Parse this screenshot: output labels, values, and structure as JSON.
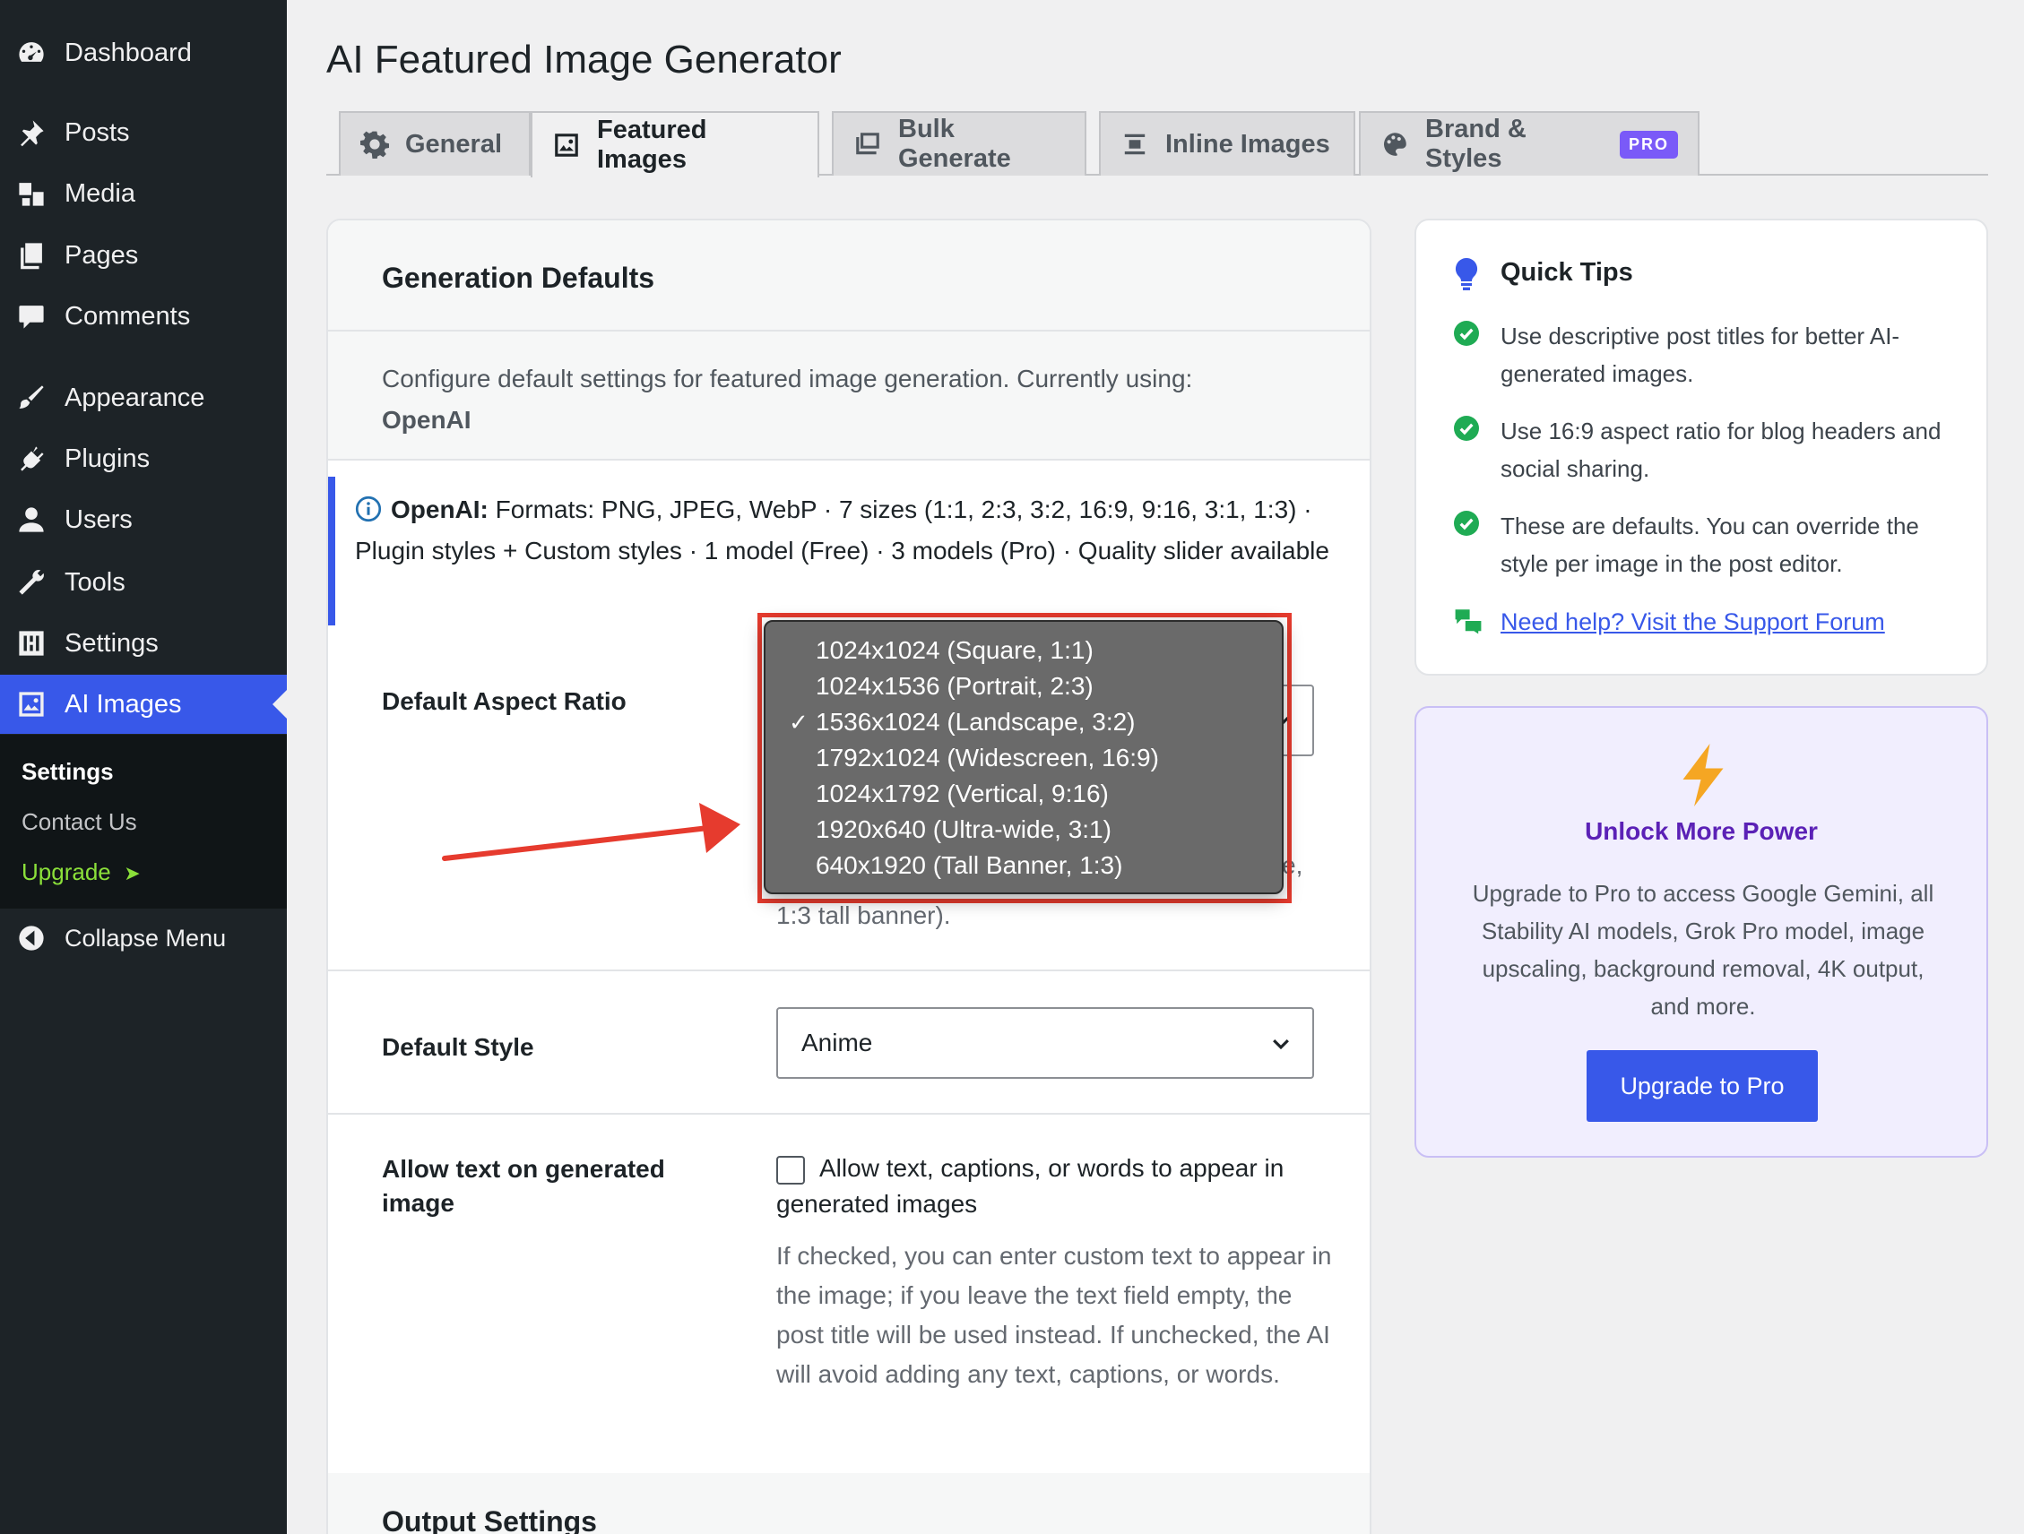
{
  "sidebar": {
    "items": [
      {
        "label": "Dashboard",
        "icon": "dashboard-icon"
      },
      {
        "label": "Posts",
        "icon": "pin-icon"
      },
      {
        "label": "Media",
        "icon": "media-icon"
      },
      {
        "label": "Pages",
        "icon": "pages-icon"
      },
      {
        "label": "Comments",
        "icon": "comment-icon"
      },
      {
        "label": "Appearance",
        "icon": "brush-icon"
      },
      {
        "label": "Plugins",
        "icon": "plug-icon"
      },
      {
        "label": "Users",
        "icon": "user-icon"
      },
      {
        "label": "Tools",
        "icon": "wrench-icon"
      },
      {
        "label": "Settings",
        "icon": "sliders-icon"
      },
      {
        "label": "AI Images",
        "icon": "image-icon",
        "active": true
      }
    ],
    "submenu": {
      "settings": "Settings",
      "contact": "Contact Us",
      "upgrade": "Upgrade",
      "upgrade_arrow": "➤"
    },
    "collapse": "Collapse Menu"
  },
  "page": {
    "title": "AI Featured Image Generator"
  },
  "tabs": [
    {
      "label": "General",
      "icon": "gear-icon"
    },
    {
      "label": "Featured Images",
      "icon": "image-icon",
      "active": true
    },
    {
      "label": "Bulk Generate",
      "icon": "images-stack-icon"
    },
    {
      "label": "Inline Images",
      "icon": "align-center-icon"
    },
    {
      "label": "Brand & Styles",
      "icon": "palette-icon",
      "badge": "PRO"
    }
  ],
  "card": {
    "title": "Generation Defaults",
    "desc": "Configure default settings for featured image generation. Currently using:",
    "provider": "OpenAI",
    "notice_label": "OpenAI:",
    "notice_text": " Formats: PNG, JPEG, WebP · 7 sizes (1:1, 2:3, 3:2, 16:9, 9:16, 3:1, 1:3) · Plugin styles + Custom styles · 1 model (Free) · 3 models (Pro) · Quality slider available",
    "aspect": {
      "label": "Default Aspect Ratio",
      "help_partial_right": "e,",
      "help_partial_tail": "1:3 tall banner).",
      "options": [
        "1024x1024 (Square, 1:1)",
        "1024x1536 (Portrait, 2:3)",
        "1536x1024 (Landscape, 3:2)",
        "1792x1024 (Widescreen, 16:9)",
        "1024x1792 (Vertical, 9:16)",
        "1920x640 (Ultra-wide, 3:1)",
        "640x1920 (Tall Banner, 1:3)"
      ],
      "selected_index": 2,
      "check_mark": "✓"
    },
    "style": {
      "label": "Default Style",
      "value": "Anime"
    },
    "allow_text": {
      "label": "Allow text on generated image",
      "checkbox_label": "Allow text, captions, or words to appear in generated images",
      "checked": false,
      "help": "If checked, you can enter custom text to appear in the image; if you leave the text field empty, the post title will be used instead. If unchecked, the AI will avoid adding any text, captions, or words."
    },
    "output_title": "Output Settings"
  },
  "tips": {
    "title": "Quick Tips",
    "items": [
      "Use descriptive post titles for better AI-generated images.",
      "Use 16:9 aspect ratio for blog headers and social sharing.",
      "These are defaults. You can override the style per image in the post editor."
    ],
    "support_link": "Need help? Visit the Support Forum"
  },
  "upsell": {
    "title": "Unlock More Power",
    "text": "Upgrade to Pro to access Google Gemini, all Stability AI models, Grok Pro model, image upscaling, background removal, 4K output, and more.",
    "button": "Upgrade to Pro"
  },
  "colors": {
    "accent": "#3858e9",
    "annotation": "#e63b2e",
    "success": "#1fab54",
    "upsell_title": "#5b21b6"
  }
}
